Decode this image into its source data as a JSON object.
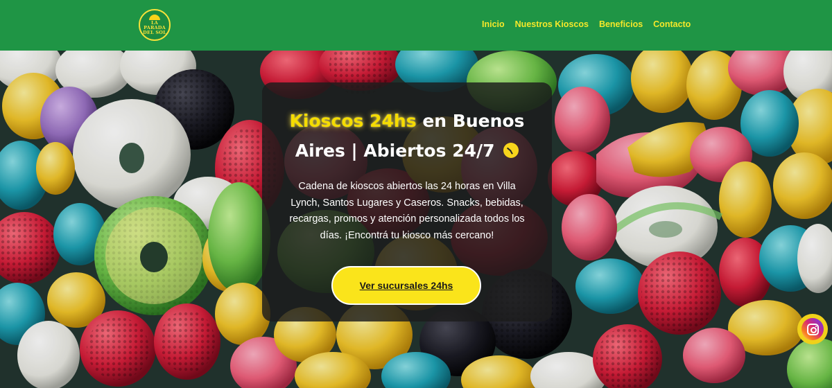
{
  "header": {
    "logo_text": "LA PARADA DEL SOL",
    "logo_line1": "LA PARADA",
    "logo_line2": "DEL SOL",
    "nav": [
      {
        "label": "Inicio"
      },
      {
        "label": "Nuestros Kioscos"
      },
      {
        "label": "Beneficios"
      },
      {
        "label": "Contacto"
      }
    ]
  },
  "hero": {
    "title_highlight": "Kioscos 24hs",
    "title_rest": " en Buenos Aires | Abiertos 24/7",
    "clock_icon": "clock-icon",
    "description": "Cadena de kioscos abiertos las 24 horas en Villa Lynch, Santos Lugares y Caseros. Snacks, bebidas, recargas, promos y atención personalizada todos los días. ¡Encontrá tu kiosco más cercano!",
    "cta_label": "Ver sucursales 24hs"
  },
  "floating": {
    "instagram_icon": "instagram-icon"
  },
  "colors": {
    "header_bg": "#1f9545",
    "nav_text": "#f5e82a",
    "cta_bg": "#fae41b",
    "highlight": "#f5dc00"
  }
}
